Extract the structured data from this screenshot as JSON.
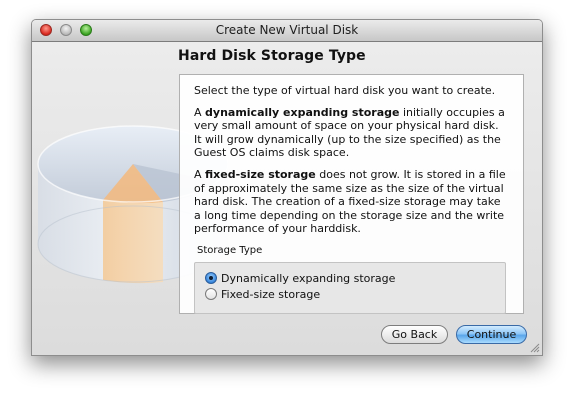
{
  "window": {
    "title": "Create New Virtual Disk"
  },
  "page": {
    "title": "Hard Disk Storage Type",
    "intro": "Select the type of virtual hard disk you want to create.",
    "dynamic_bold": "dynamically expanding storage",
    "dynamic_rest": " initially occupies a very small amount of space on your physical hard disk. It will grow dynamically (up to the size specified) as the Guest OS claims disk space.",
    "fixed_bold": "fixed-size storage",
    "fixed_rest": " does not grow. It is stored in a file of approximately the same size as the size of the virtual hard disk. The creation of a fixed-size storage may take a long time depending on the storage size and the write performance of your harddisk.",
    "article": "A "
  },
  "storage_type": {
    "group_label": "Storage Type",
    "options": [
      {
        "label": "Dynamically expanding storage",
        "selected": true
      },
      {
        "label": "Fixed-size storage",
        "selected": false
      }
    ]
  },
  "buttons": {
    "back": "Go Back",
    "continue": "Continue"
  },
  "icons": {
    "close": "close-icon",
    "minimize": "minimize-icon",
    "zoom": "zoom-icon",
    "disk_art": "hard-disk-icon",
    "resize": "resize-grip-icon"
  },
  "colors": {
    "accent": "#5aa6ea",
    "window_bg": "#e8e8e8"
  }
}
